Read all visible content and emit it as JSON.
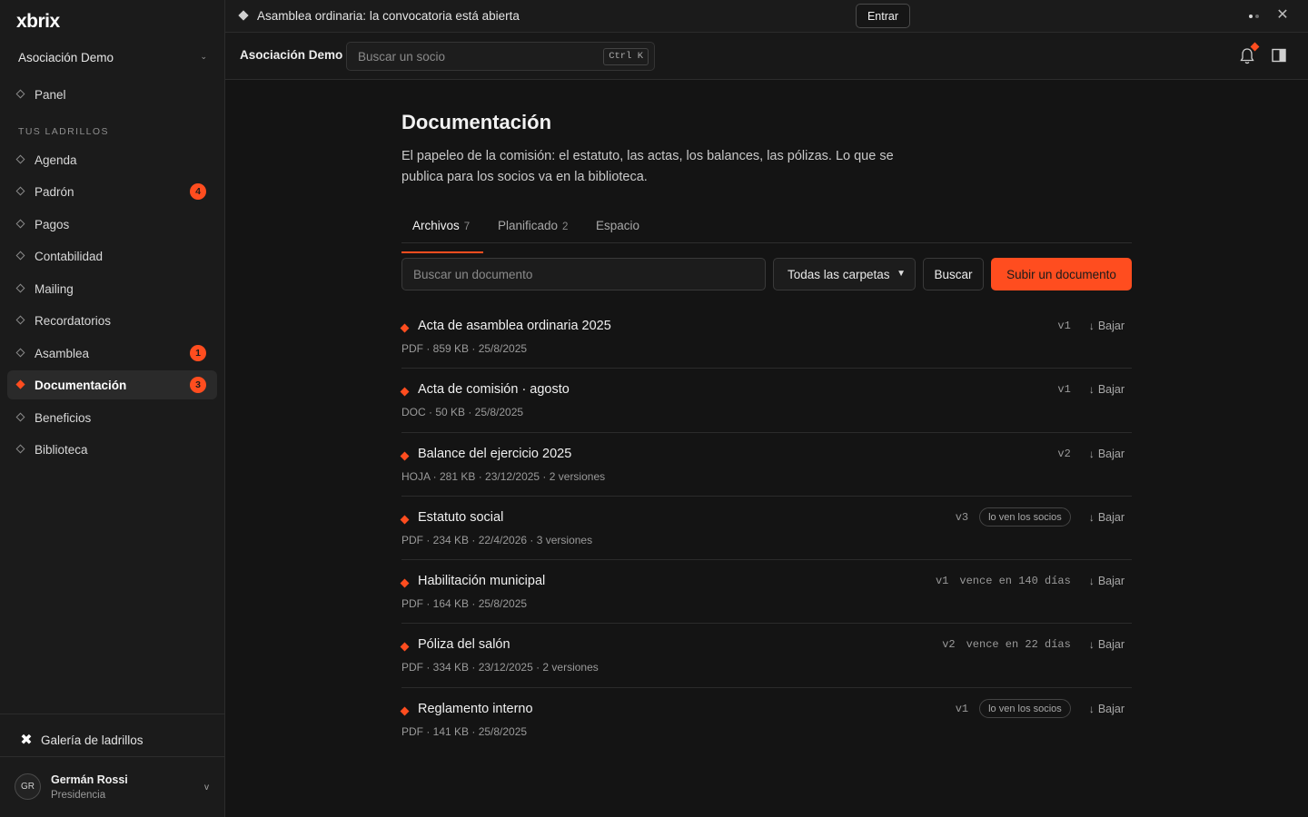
{
  "brand": {
    "logo": "xbrix",
    "accent": "#ff4d1f"
  },
  "sidebar": {
    "org_name": "Asociación Demo",
    "panel_label": "Panel",
    "section_label": "TUS LADRILLOS",
    "items": [
      {
        "label": "Agenda",
        "badge": ""
      },
      {
        "label": "Padrón",
        "badge": "4"
      },
      {
        "label": "Pagos",
        "badge": ""
      },
      {
        "label": "Contabilidad",
        "badge": ""
      },
      {
        "label": "Mailing",
        "badge": ""
      },
      {
        "label": "Recordatorios",
        "badge": ""
      },
      {
        "label": "Asamblea",
        "badge": "1"
      },
      {
        "label": "Documentación",
        "badge": "3",
        "active": true
      },
      {
        "label": "Beneficios",
        "badge": ""
      },
      {
        "label": "Biblioteca",
        "badge": ""
      }
    ],
    "gallery_label": "Galería de ladrillos",
    "user": {
      "initials": "GR",
      "name": "Germán Rossi",
      "role": "Presidencia"
    }
  },
  "announcement": {
    "text": "Asamblea ordinaria: la convocatoria está abierta",
    "button": "Entrar"
  },
  "header": {
    "org_name": "Asociación Demo",
    "search_placeholder": "Buscar un socio",
    "shortcut": "Ctrl K"
  },
  "page": {
    "title": "Documentación",
    "description": "El papeleo de la comisión: el estatuto, las actas, los balances, las pólizas. Lo que se publica para los socios va en la biblioteca.",
    "tabs": [
      {
        "label": "Archivos",
        "count": "7",
        "active": true
      },
      {
        "label": "Planificado",
        "count": "2"
      },
      {
        "label": "Espacio",
        "count": ""
      }
    ],
    "toolbar": {
      "search_placeholder": "Buscar un documento",
      "folder_filter": "Todas las carpetas",
      "search_button": "Buscar",
      "upload_button": "Subir un documento"
    },
    "documents": [
      {
        "title": "Acta de asamblea ordinaria 2025",
        "meta": "PDF · 859 KB · 25/8/2025",
        "version": "v1",
        "expiry": "",
        "visibility": "",
        "download": "Bajar"
      },
      {
        "title": "Acta de comisión · agosto",
        "meta": "DOC · 50 KB · 25/8/2025",
        "version": "v1",
        "expiry": "",
        "visibility": "",
        "download": "Bajar"
      },
      {
        "title": "Balance del ejercicio 2025",
        "meta": "HOJA · 281 KB · 23/12/2025 · 2 versiones",
        "version": "v2",
        "expiry": "",
        "visibility": "",
        "download": "Bajar"
      },
      {
        "title": "Estatuto social",
        "meta": "PDF · 234 KB · 22/4/2026 · 3 versiones",
        "version": "v3",
        "expiry": "",
        "visibility": "lo ven los socios",
        "download": "Bajar"
      },
      {
        "title": "Habilitación municipal",
        "meta": "PDF · 164 KB · 25/8/2025",
        "version": "v1",
        "expiry": "vence en 140 días",
        "visibility": "",
        "download": "Bajar"
      },
      {
        "title": "Póliza del salón",
        "meta": "PDF · 334 KB · 23/12/2025 · 2 versiones",
        "version": "v2",
        "expiry": "vence en 22 días",
        "visibility": "",
        "download": "Bajar"
      },
      {
        "title": "Reglamento interno",
        "meta": "PDF · 141 KB · 25/8/2025",
        "version": "v1",
        "expiry": "",
        "visibility": "lo ven los socios",
        "download": "Bajar"
      }
    ]
  }
}
